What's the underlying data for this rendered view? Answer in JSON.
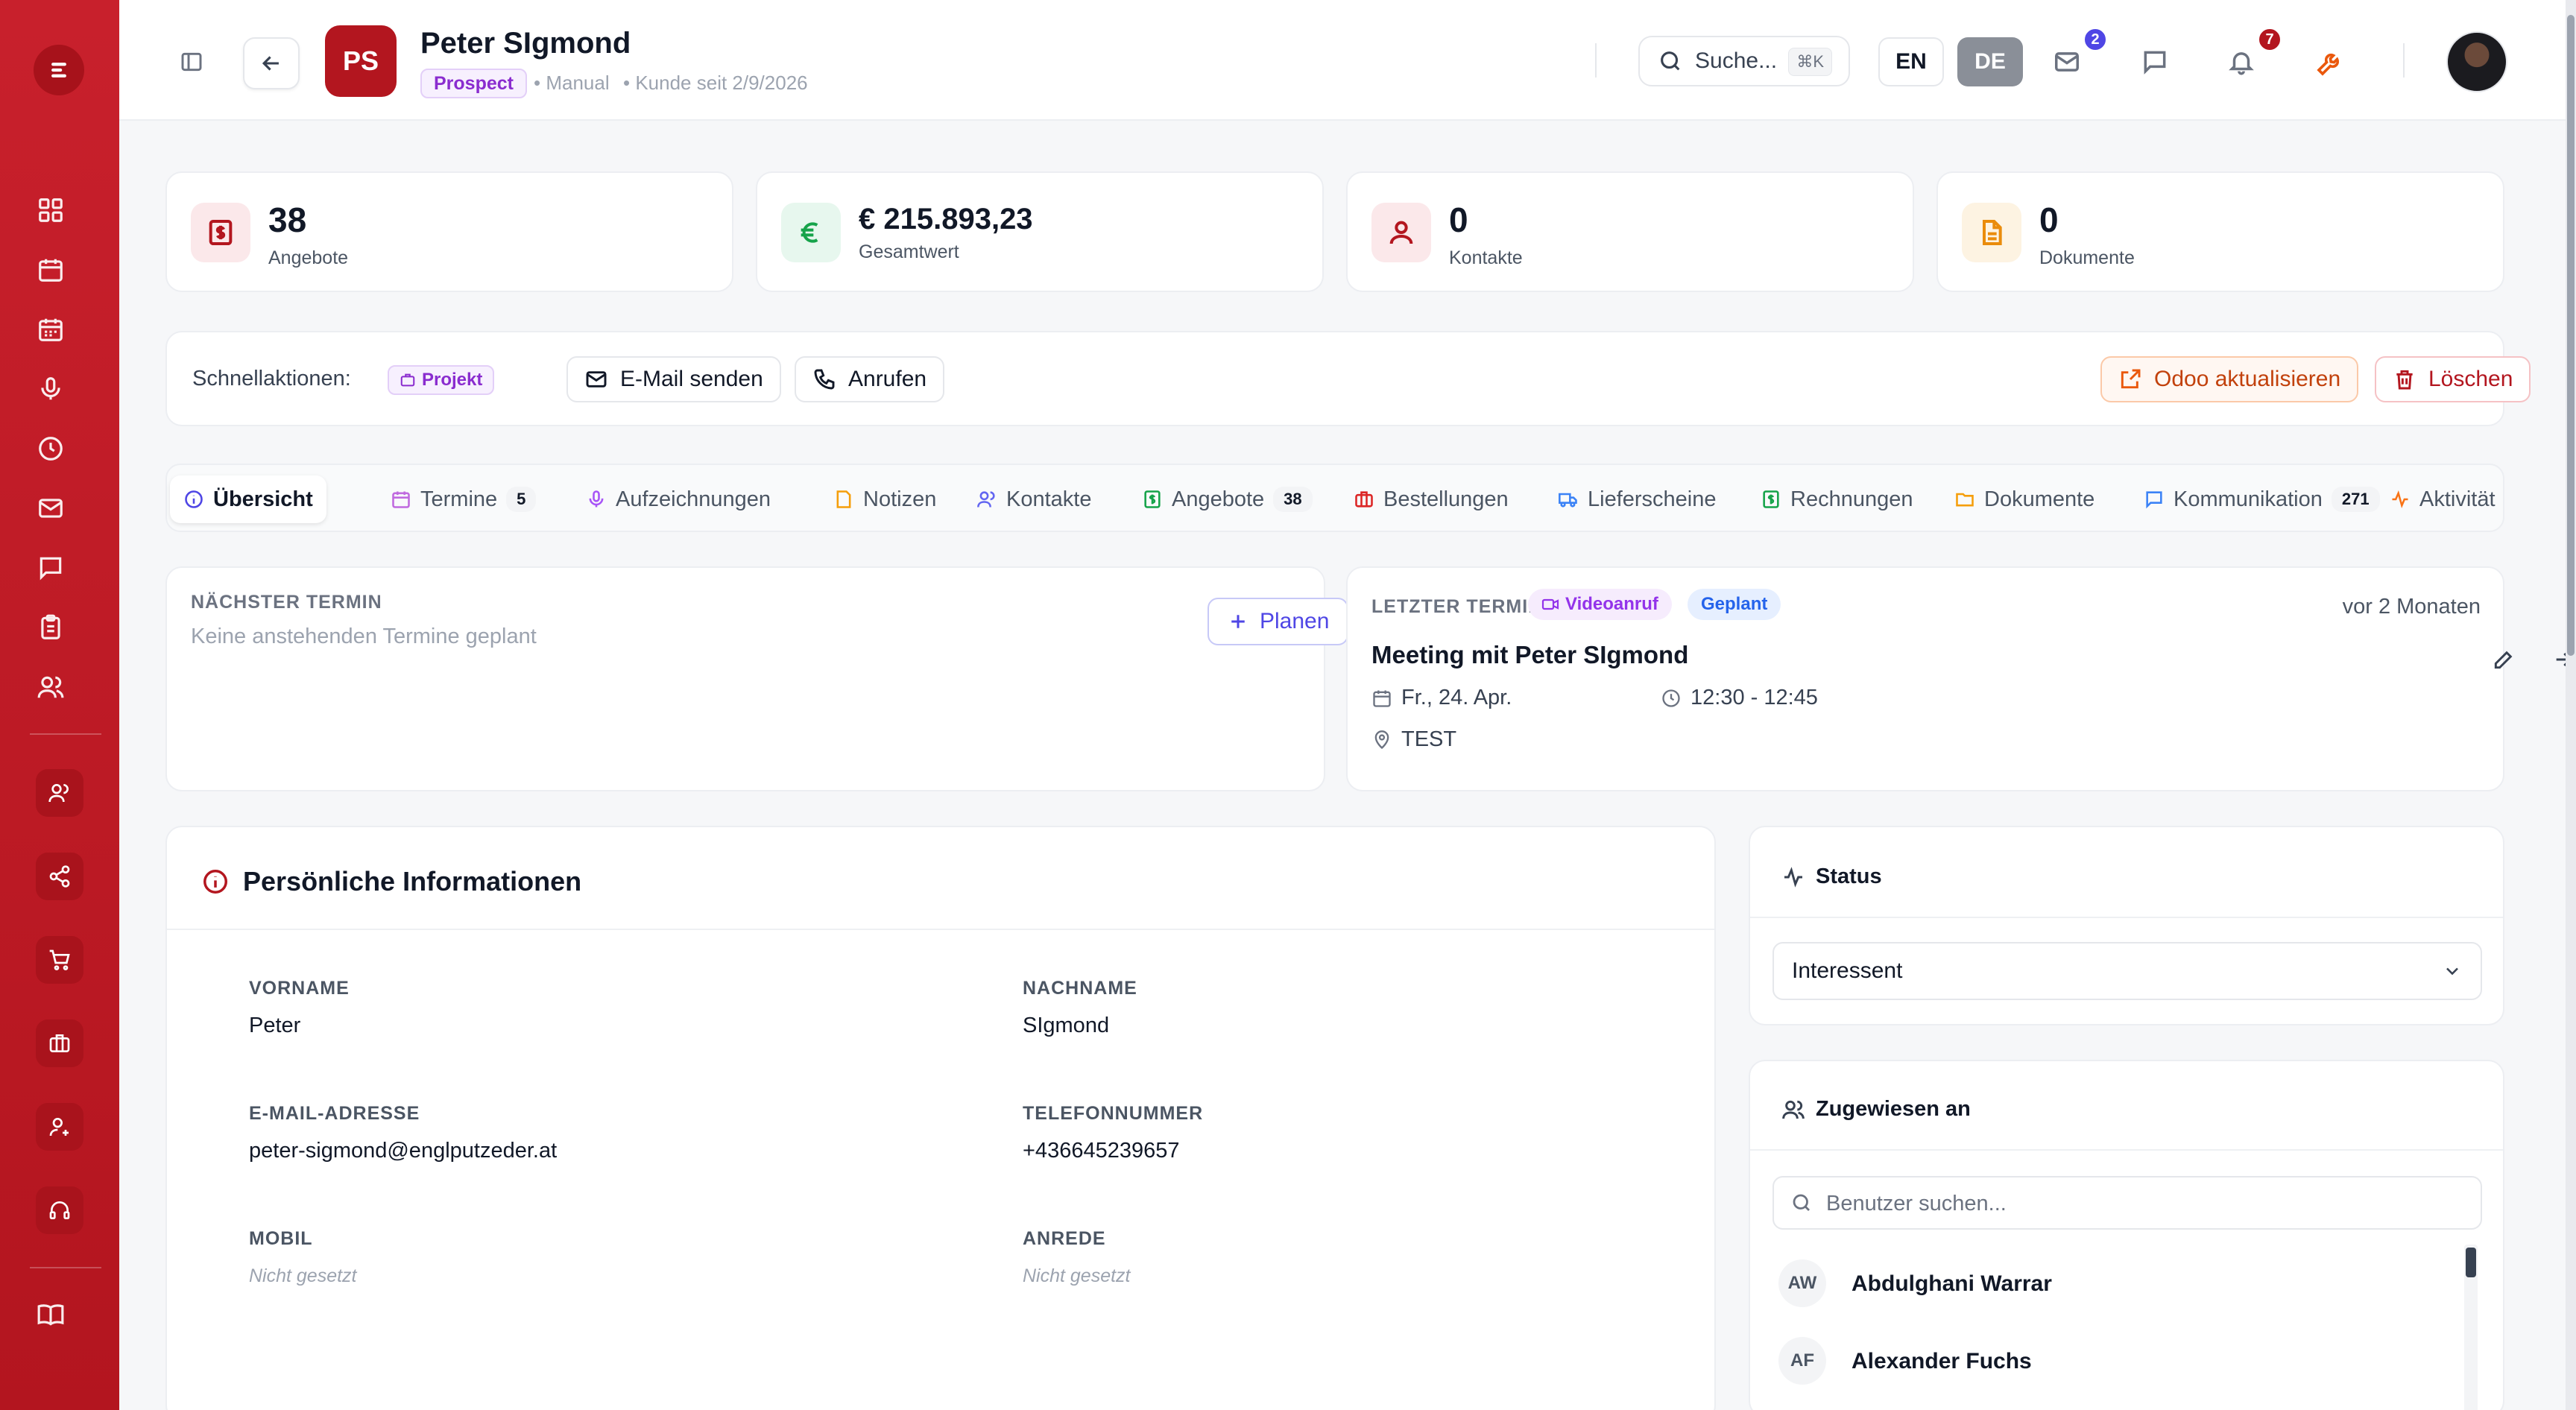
{
  "colors": {
    "brand": "#b3161f",
    "accent_orange": "#ea580c",
    "accent_purple": "#7c3aed",
    "accent_green": "#16a34a",
    "blue": "#4f46e5"
  },
  "topbar": {
    "initials": "PS",
    "name": "Peter SIgmond",
    "status_badge": "Prospect",
    "source": "• Manual",
    "customer_since": "• Kunde seit 2/9/2026",
    "search_label": "Suche...",
    "search_shortcut": "⌘K",
    "lang_en": "EN",
    "lang_de": "DE",
    "mail_count": "2",
    "notification_count": "7"
  },
  "stats": [
    {
      "value": "38",
      "label": "Angebote",
      "icon": "dollar-doc-icon"
    },
    {
      "value": "€ 215.893,23",
      "label": "Gesamtwert",
      "icon": "euro-icon"
    },
    {
      "value": "0",
      "label": "Kontakte",
      "icon": "user-icon"
    },
    {
      "value": "0",
      "label": "Dokumente",
      "icon": "document-icon"
    }
  ],
  "quick_actions": {
    "label": "Schnellaktionen:",
    "project": "Projekt",
    "email": "E-Mail senden",
    "call": "Anrufen",
    "odoo": "Odoo aktualisieren",
    "delete": "Löschen"
  },
  "tabs": [
    {
      "label": "Übersicht",
      "icon": "info-icon"
    },
    {
      "label": "Termine",
      "count": "5",
      "icon": "calendar-icon"
    },
    {
      "label": "Aufzeichnungen",
      "icon": "microphone-icon"
    },
    {
      "label": "Notizen",
      "icon": "note-icon"
    },
    {
      "label": "Kontakte",
      "icon": "users-icon"
    },
    {
      "label": "Angebote",
      "count": "38",
      "icon": "dollar-doc-icon"
    },
    {
      "label": "Bestellungen",
      "icon": "briefcase-icon"
    },
    {
      "label": "Lieferscheine",
      "icon": "truck-icon"
    },
    {
      "label": "Rechnungen",
      "icon": "invoice-icon"
    },
    {
      "label": "Dokumente",
      "icon": "folder-icon"
    },
    {
      "label": "Kommunikation",
      "count": "271",
      "icon": "message-icon"
    },
    {
      "label": "Aktivität",
      "icon": "activity-icon"
    }
  ],
  "next_appointment": {
    "title": "NÄCHSTER TERMIN",
    "empty": "Keine anstehenden Termine geplant",
    "plan_button": "Planen"
  },
  "last_appointment": {
    "title": "LETZTER TERMIN",
    "type_badge": "Videoanruf",
    "state_badge": "Geplant",
    "relative_time": "vor 2 Monaten",
    "meeting_title": "Meeting mit Peter SIgmond",
    "date": "Fr., 24. Apr.",
    "time": "12:30 - 12:45",
    "location": "TEST"
  },
  "personal_info": {
    "title": "Persönliche Informationen",
    "fields": {
      "first_name_label": "VORNAME",
      "first_name": "Peter",
      "last_name_label": "NACHNAME",
      "last_name": "SIgmond",
      "email_label": "E-MAIL-ADRESSE",
      "email": "peter-sigmond@englputzeder.at",
      "phone_label": "TELEFONNUMMER",
      "phone": "+436645239657",
      "mobile_label": "MOBIL",
      "mobile": "Nicht gesetzt",
      "salutation_label": "ANREDE",
      "salutation": "Nicht gesetzt"
    }
  },
  "status_card": {
    "title": "Status",
    "selected": "Interessent"
  },
  "assigned_card": {
    "title": "Zugewiesen an",
    "search_placeholder": "Benutzer suchen...",
    "users": [
      {
        "initials": "AW",
        "name": "Abdulghani Warrar"
      },
      {
        "initials": "AF",
        "name": "Alexander Fuchs"
      }
    ]
  }
}
